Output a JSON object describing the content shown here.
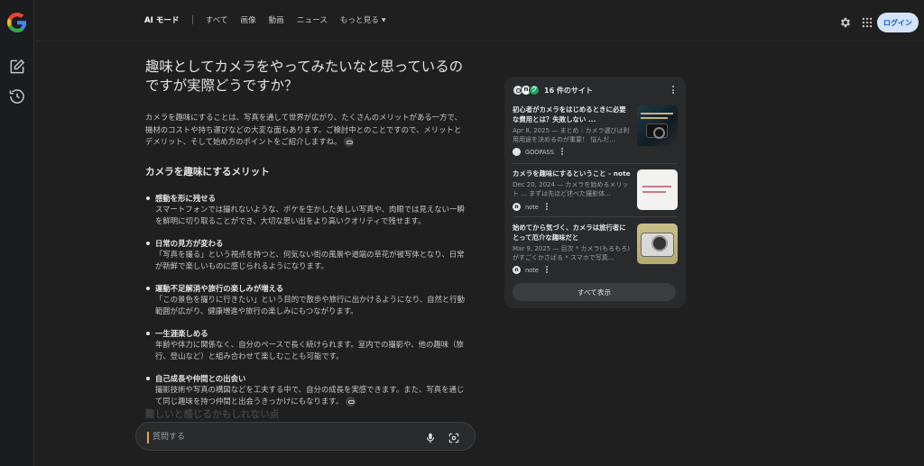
{
  "nav": {
    "tabs": [
      {
        "label": "AI モード",
        "active": true
      },
      {
        "label": "すべて"
      },
      {
        "label": "画像"
      },
      {
        "label": "動画"
      },
      {
        "label": "ニュース"
      },
      {
        "label": "もっと見る"
      }
    ]
  },
  "header": {
    "login_label": "ログイン"
  },
  "answer": {
    "question": "趣味としてカメラをやってみたいなと思っているのですが実際どうですか？",
    "intro": "カメラを趣味にすることは、写真を通して世界が広がり、たくさんのメリットがある一方で、機材のコストや持ち運びなどの大変な面もあります。ご検討中とのことですので、メリットとデメリット、そして始め方のポイントをご紹介しますね。",
    "section_heading": "カメラを趣味にするメリット",
    "merits": [
      {
        "title": "感動を形に残せる",
        "body": "スマートフォンでは撮れないような、ボケを生かした美しい写真や、肉眼では見えない一瞬を鮮明に切り取ることができ、大切な思い出をより高いクオリティで残せます。"
      },
      {
        "title": "日常の見方が変わる",
        "body": "「写真を撮る」という視点を持つと、何気ない街の風景や道端の草花が被写体となり、日常が新鮮で楽しいものに感じられるようになります。"
      },
      {
        "title": "運動不足解消や旅行の楽しみが増える",
        "body": "「この景色を撮りに行きたい」という目的で散歩や旅行に出かけるようになり、自然と行動範囲が広がり、健康増進や旅行の楽しみにもつながります。"
      },
      {
        "title": "一生涯楽しめる",
        "body": "年齢や体力に関係なく、自分のペースで長く続けられます。室内での撮影や、他の趣味（旅行、登山など）と組み合わせて楽しむことも可能です。"
      },
      {
        "title": "自己成長や仲間との出会い",
        "body": "撮影技術や写真の構図などを工夫する中で、自分の成長を実感できます。また、写真を通じて同じ趣味を持つ仲間と出会うきっかけにもなります。"
      }
    ],
    "faded_heading": "難しいと感じるかもしれない点"
  },
  "ask_box": {
    "placeholder": "質問する"
  },
  "sources": {
    "count_label": "16 件のサイト",
    "items": [
      {
        "title": "初心者がカメラをはじめるときに必要な費用とは？失敗しない ...",
        "snippet": "Apr 8, 2025 — まとめ｜カメラ選びは利用用途を決めるのが重要！ 悩んだ...",
        "site": "GOOPASS"
      },
      {
        "title": "カメラを趣味にするということ - note",
        "snippet": "Dec 20, 2024 — カメラを始めるメリット ... まずは先ほど述べた撮影体...",
        "site": "note"
      },
      {
        "title": "始めてから気づく、カメラは旅行者にとって厄介な趣味だと",
        "snippet": "Mar 9, 2025 — 目次 * カメラ(もるもろ)がすごくかさばる * スマホで写真...",
        "site": "note"
      }
    ],
    "show_all_label": "すべて表示"
  },
  "colors": {
    "background": "#1f1f1f",
    "card": "#282a2c",
    "login_bg": "#d3e3fd",
    "login_text": "#0b57d0"
  }
}
